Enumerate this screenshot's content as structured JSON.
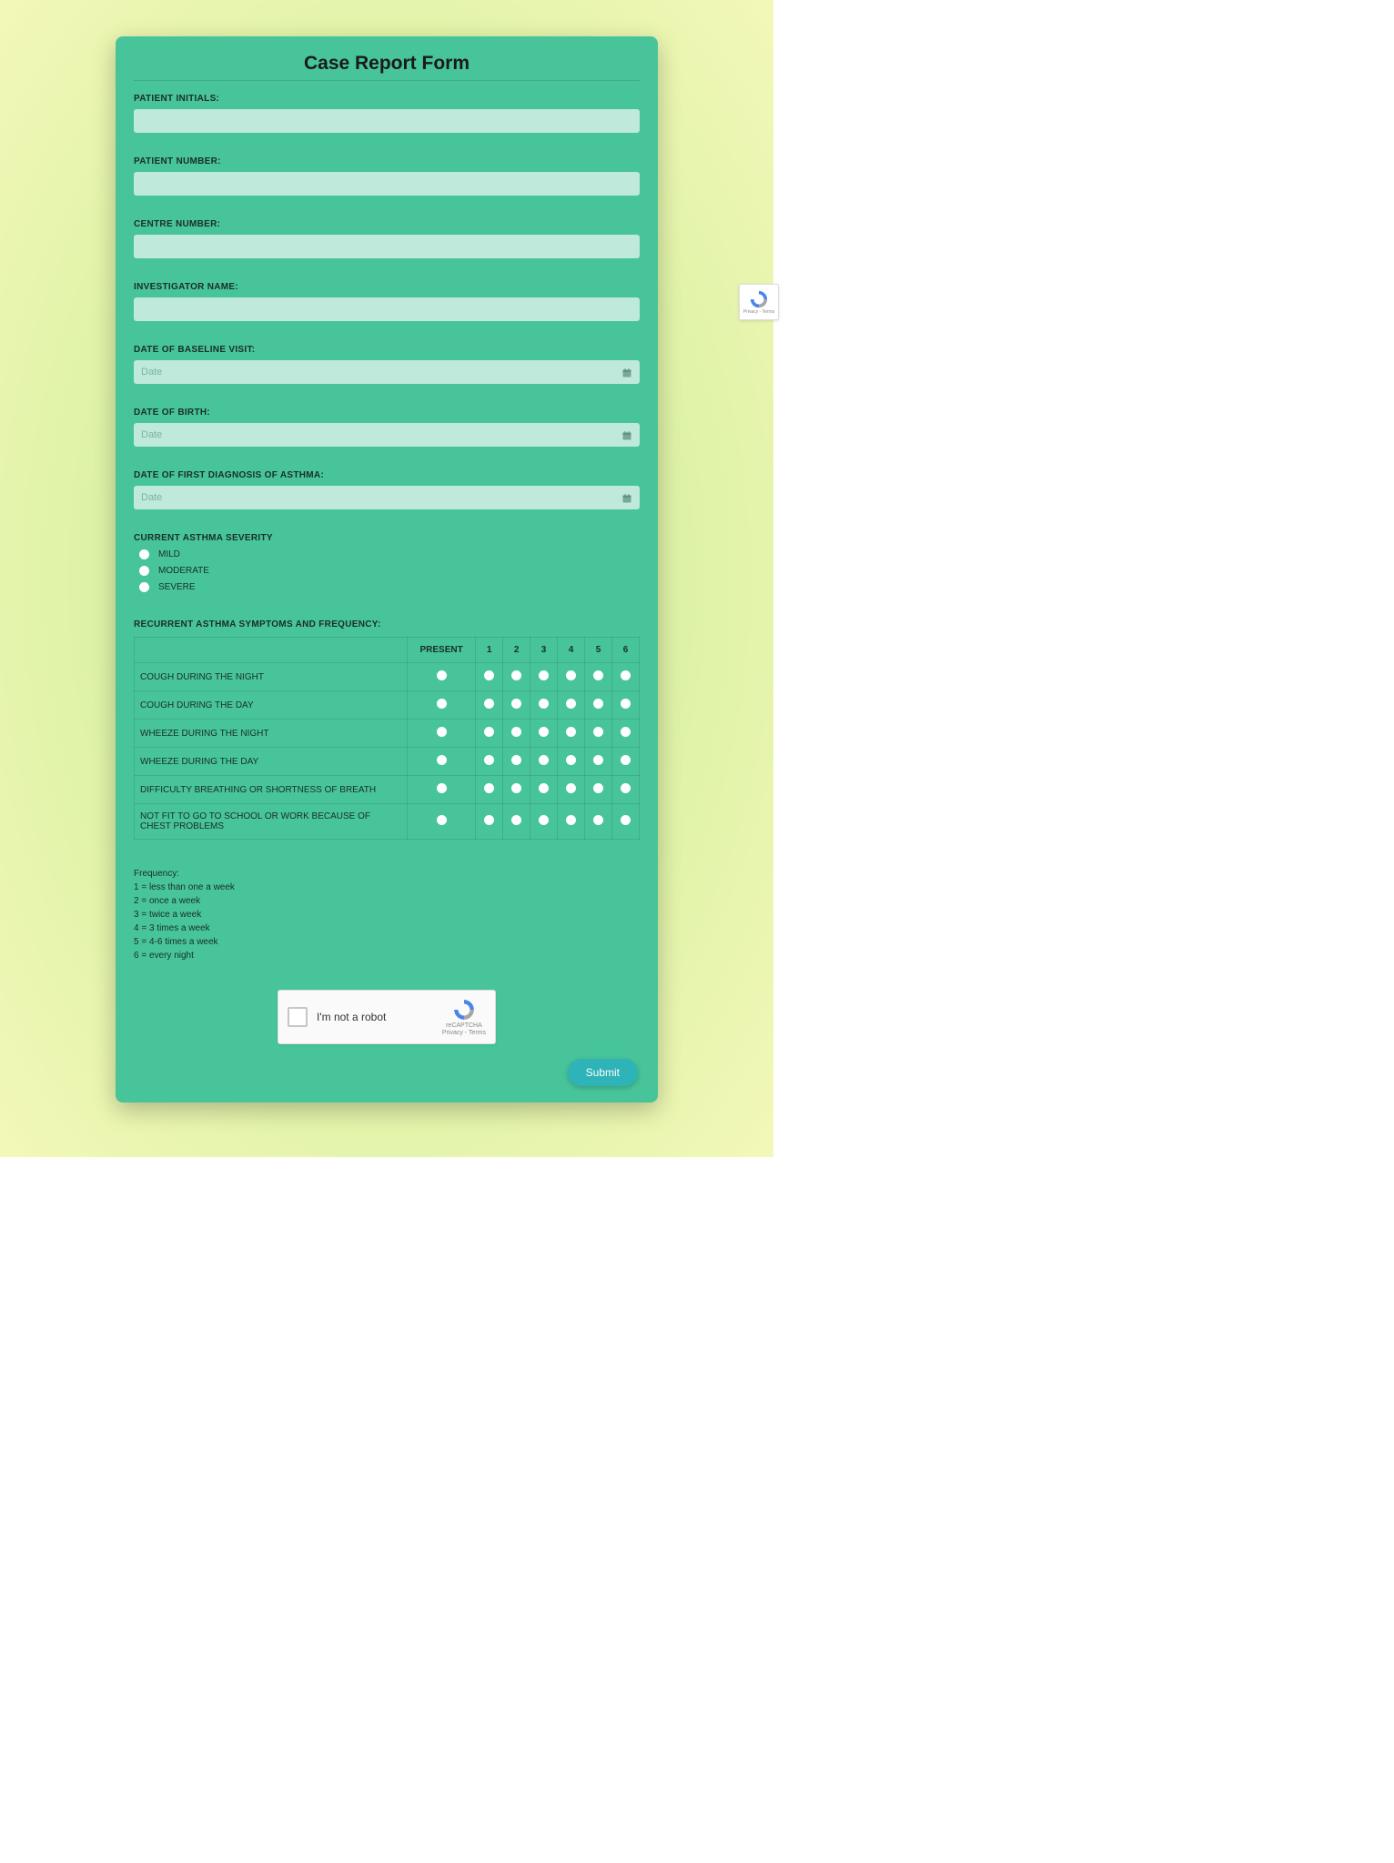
{
  "title": "Case Report Form",
  "fields": {
    "patient_initials": {
      "label": "PATIENT INITIALS:",
      "value": ""
    },
    "patient_number": {
      "label": "PATIENT NUMBER:",
      "value": ""
    },
    "centre_number": {
      "label": "CENTRE NUMBER:",
      "value": ""
    },
    "investigator_name": {
      "label": "INVESTIGATOR NAME:",
      "value": ""
    },
    "date_baseline": {
      "label": "DATE OF BASELINE VISIT:",
      "value": "",
      "placeholder": "Date"
    },
    "date_birth": {
      "label": "DATE OF BIRTH:",
      "value": "",
      "placeholder": "Date"
    },
    "date_diagnosis": {
      "label": "DATE OF FIRST DIAGNOSIS OF ASTHMA:",
      "value": "",
      "placeholder": "Date"
    }
  },
  "severity": {
    "label": "CURRENT ASTHMA SEVERITY",
    "options": [
      "MILD",
      "MODERATE",
      "SEVERE"
    ],
    "selected": null
  },
  "matrix": {
    "label": "RECURRENT ASTHMA SYMPTOMS AND FREQUENCY:",
    "columns": [
      "PRESENT",
      "1",
      "2",
      "3",
      "4",
      "5",
      "6"
    ],
    "rows": [
      "COUGH DURING THE NIGHT",
      "COUGH DURING THE DAY",
      "WHEEZE DURING THE NIGHT",
      "WHEEZE DURING THE DAY",
      "DIFFICULTY BREATHING OR SHORTNESS OF BREATH",
      "NOT FIT TO GO TO SCHOOL OR WORK BECAUSE OF CHEST PROBLEMS"
    ]
  },
  "legend": {
    "title": "Frequency:",
    "lines": [
      "1 = less than one a week",
      "2 = once a week",
      "3 = twice a week",
      "4 = 3 times a week",
      "5 = 4-6 times a week",
      "6 = every night"
    ]
  },
  "captcha": {
    "text": "I'm not a robot",
    "brand": "reCAPTCHA",
    "terms": "Privacy - Terms"
  },
  "submit_label": "Submit"
}
